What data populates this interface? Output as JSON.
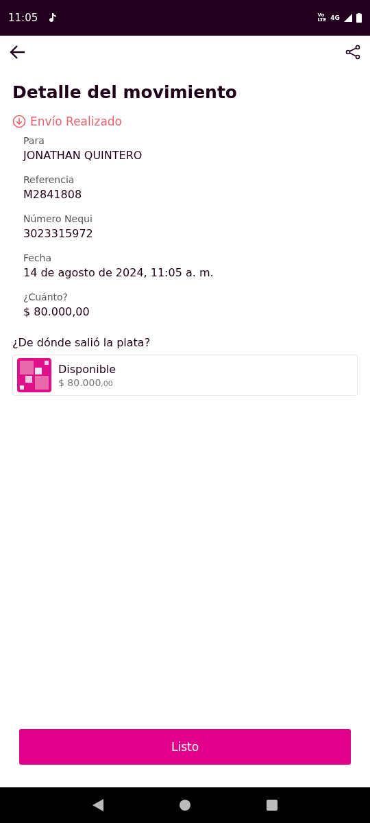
{
  "status_bar": {
    "time": "11:05",
    "volte_top": "Vo",
    "volte_bottom": "LTE",
    "network": "4G"
  },
  "header": {
    "title": "Detalle del movimiento"
  },
  "status": {
    "label": "Envío Realizado"
  },
  "fields": [
    {
      "label": "Para",
      "value": "JONATHAN QUINTERO"
    },
    {
      "label": "Referencia",
      "value": "M2841808"
    },
    {
      "label": "Número Nequi",
      "value": "3023315972"
    },
    {
      "label": "Fecha",
      "value": "14 de agosto de 2024, 11:05 a. m."
    },
    {
      "label": "¿Cuánto?",
      "value": "$ 80.000,00"
    }
  ],
  "source": {
    "heading": "¿De dónde salió la plata?",
    "name": "Disponible",
    "amount": "$ 80.000",
    "cents": ",00"
  },
  "button": {
    "label": "Listo"
  }
}
